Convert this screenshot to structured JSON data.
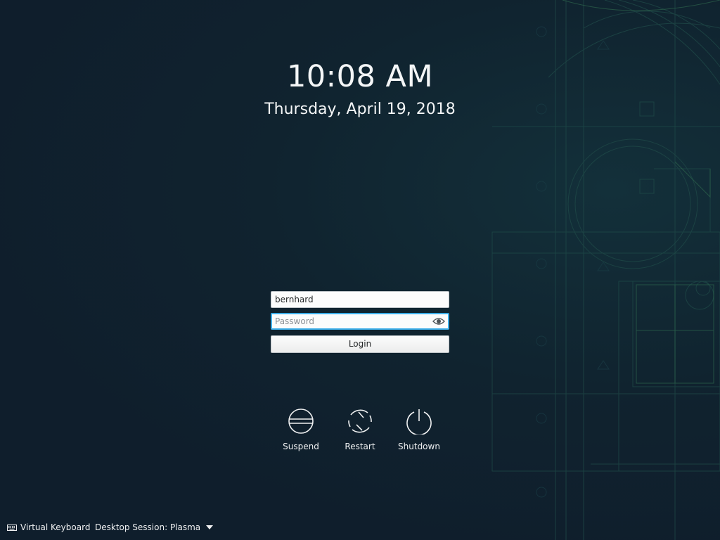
{
  "clock": {
    "time": "10:08 AM",
    "date": "Thursday, April 19, 2018"
  },
  "login": {
    "username_value": "bernhard",
    "password_value": "",
    "password_placeholder": "Password",
    "login_label": "Login"
  },
  "actions": [
    {
      "label": "Suspend",
      "icon": "suspend-icon"
    },
    {
      "label": "Restart",
      "icon": "restart-icon"
    },
    {
      "label": "Shutdown",
      "icon": "shutdown-icon"
    }
  ],
  "footer": {
    "virtual_keyboard_label": "Virtual Keyboard",
    "session_label": "Desktop Session: Plasma"
  },
  "colors": {
    "background": "#0f1e2c",
    "focus_accent": "#3daee9",
    "text": "#eff0f1"
  }
}
